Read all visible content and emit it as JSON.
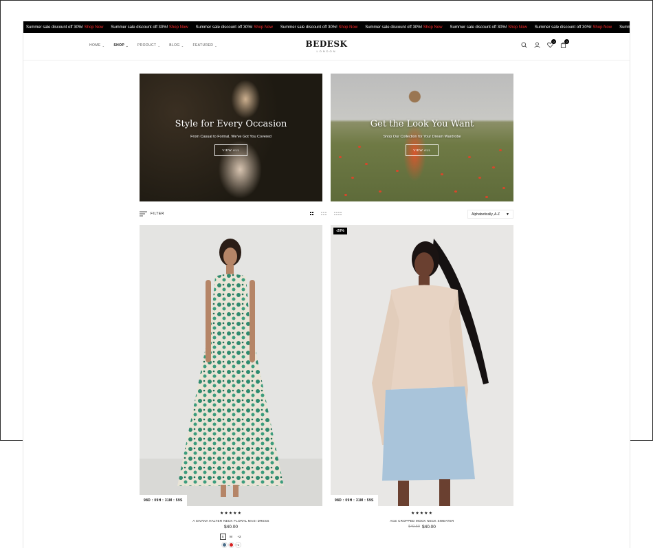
{
  "announcement": {
    "text": "Summer sale discount off 30%!",
    "link": "Shop Now",
    "repeat_count": 8
  },
  "header": {
    "nav": [
      {
        "label": "HOME",
        "active": false
      },
      {
        "label": "SHOP",
        "active": true
      },
      {
        "label": "PRODUCT",
        "active": false
      },
      {
        "label": "BLOG",
        "active": false
      },
      {
        "label": "FEATURED",
        "active": false
      }
    ],
    "logo": {
      "name": "BEDESK",
      "tagline": "LONDON"
    },
    "icons": [
      "search-icon",
      "user-icon",
      "heart-icon",
      "bag-icon"
    ],
    "wishlist_count": "0",
    "cart_count": "0"
  },
  "banners": [
    {
      "title": "Style for Every Occasion",
      "subtitle": "From Casual to Formal, We've Got You Covered",
      "button": "VIEW ALL"
    },
    {
      "title": "Get the Look You Want",
      "subtitle": "Shop Our Collection for Your Dream Wardrobe",
      "button": "VIEW ALL"
    }
  ],
  "toolbar": {
    "filter_label": "FILTER",
    "grid_options": [
      "2-columns",
      "3-columns",
      "4-columns"
    ],
    "active_grid": "2-columns",
    "sort_value": "Alphabetically, A-Z"
  },
  "products": [
    {
      "name": "A SIVANA HALTER NECK FLORAL MAXI DRESS",
      "price": "$40.00",
      "old_price": "",
      "badge": "",
      "countdown": "98D : 09H : 31M : 59S",
      "rating": "★★★★★",
      "sizes": [
        "S",
        "M",
        "+2"
      ],
      "selected_size": "S",
      "swatches": [
        "#4d6f8a",
        "#d62020"
      ],
      "swatch_more": "+2"
    },
    {
      "name": "ACE CROPPED MOCK NECK SWEATER",
      "price": "$40.00",
      "old_price": "$40.50",
      "badge": "-20%",
      "countdown": "98D : 09H : 31M : 59S",
      "rating": "★★★★★",
      "sizes": [],
      "swatches": []
    }
  ],
  "colors": {
    "announcement_bg": "#000000",
    "promo_link": "#ff2b2b",
    "badge_bg": "#000000"
  }
}
